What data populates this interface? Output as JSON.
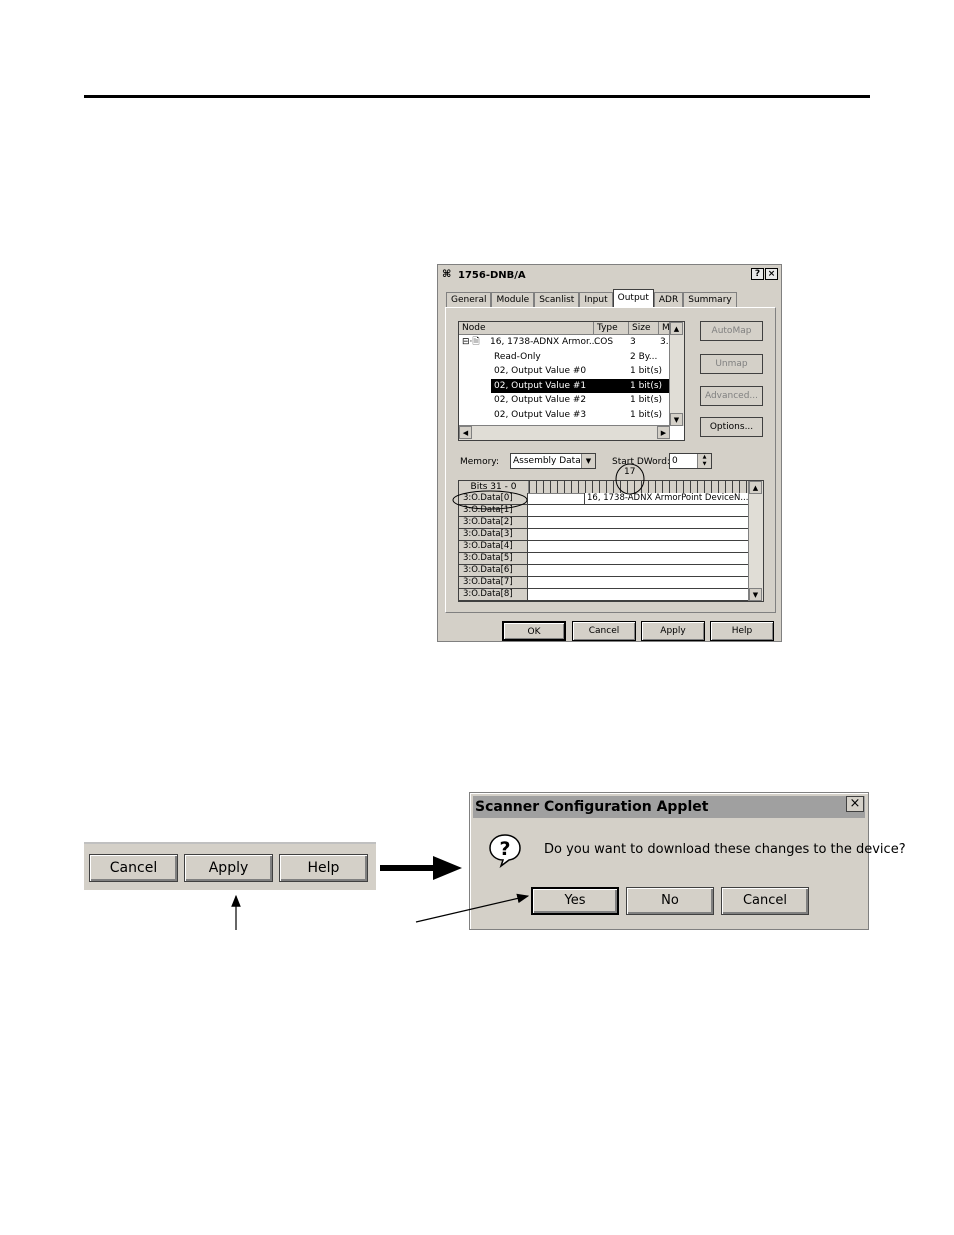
{
  "dialog1": {
    "title": "1756-DNB/A",
    "title_buttons": [
      "?",
      "×"
    ],
    "tabs": [
      "General",
      "Module",
      "Scanlist",
      "Input",
      "Output",
      "ADR",
      "Summary"
    ],
    "active_tab": "Output",
    "tree": {
      "columns": [
        "Node",
        "Type",
        "Size",
        "M"
      ],
      "rows": [
        {
          "node": "16, 1738-ADNX Armor...",
          "type": "COS",
          "size": "3",
          "m": "3.(",
          "selected": false
        },
        {
          "node": "Read-Only",
          "type": "",
          "size": "2 By...",
          "m": "",
          "selected": false
        },
        {
          "node": "02, Output Value #0",
          "type": "",
          "size": "1 bit(s)",
          "m": "",
          "selected": false
        },
        {
          "node": "02, Output Value #1",
          "type": "",
          "size": "1 bit(s)",
          "m": "",
          "selected": true
        },
        {
          "node": "02, Output Value #2",
          "type": "",
          "size": "1 bit(s)",
          "m": "",
          "selected": false
        },
        {
          "node": "02, Output Value #3",
          "type": "",
          "size": "1 bit(s)",
          "m": "",
          "selected": false
        }
      ]
    },
    "side_buttons": {
      "automap": "AutoMap",
      "unmap": "Unmap",
      "advanced": "Advanced...",
      "options": "Options..."
    },
    "memory_label": "Memory:",
    "memory_value": "Assembly Data",
    "start_dword_label": "Start DWord:",
    "start_dword_value": "0",
    "callout_number": "17",
    "grid": {
      "bits_label": "Bits 31 - 0",
      "rows": [
        "3:O.Data[0]",
        "3:O.Data[1]",
        "3:O.Data[2]",
        "3:O.Data[3]",
        "3:O.Data[4]",
        "3:O.Data[5]",
        "3:O.Data[6]",
        "3:O.Data[7]",
        "3:O.Data[8]"
      ],
      "row0_cell": "16, 1738-ADNX ArmorPoint DeviceN..."
    },
    "buttons": {
      "ok": "OK",
      "cancel": "Cancel",
      "apply": "Apply",
      "help": "Help"
    }
  },
  "zoom_buttons": {
    "cancel": "Cancel",
    "apply": "Apply",
    "help": "Help"
  },
  "dialog2": {
    "title": "Scanner Configuration Applet",
    "close": "×",
    "icon_glyph": "?",
    "message": "Do you want to download these changes to the device?",
    "buttons": {
      "yes": "Yes",
      "no": "No",
      "cancel": "Cancel"
    }
  }
}
